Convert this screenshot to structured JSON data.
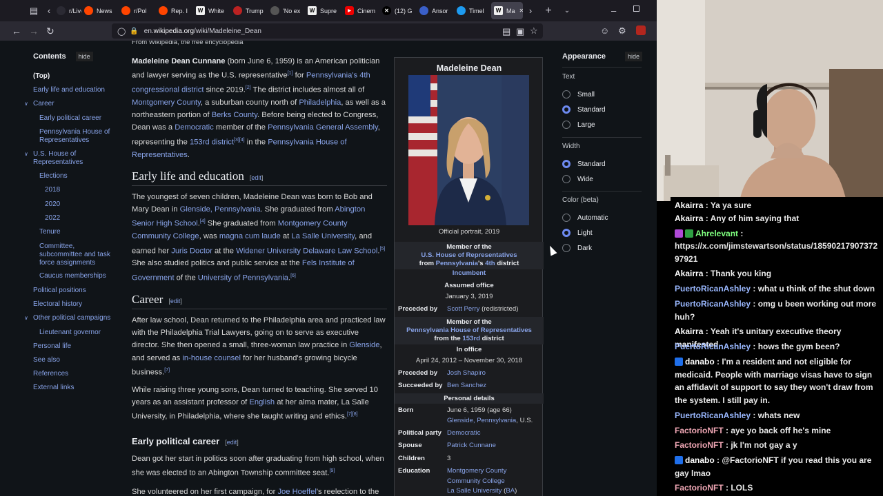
{
  "tabs": [
    {
      "label": "r/Live:",
      "fav": "",
      "color": "#2b2a33"
    },
    {
      "label": "News",
      "fav": "reddit",
      "color": "#ff4500"
    },
    {
      "label": "r/Pol",
      "fav": "reddit",
      "color": "#ff4500"
    },
    {
      "label": "Rep. I",
      "fav": "reddit",
      "color": "#ff4500"
    },
    {
      "label": "White",
      "fav": "W",
      "color": "#f0f0f0"
    },
    {
      "label": "Trump",
      "fav": "",
      "color": "#b22"
    },
    {
      "label": "'No ex",
      "fav": "",
      "color": "#555"
    },
    {
      "label": "Supre",
      "fav": "W",
      "color": "#f0f0f0"
    },
    {
      "label": "Cinem",
      "fav": "yt",
      "color": "#e00"
    },
    {
      "label": "(12) G",
      "fav": "X",
      "color": "#000"
    },
    {
      "label": "Ansor",
      "fav": "",
      "color": "#3a5fc8"
    },
    {
      "label": "Timel",
      "fav": "",
      "color": "#1d9bf0"
    },
    {
      "label": "Ma",
      "fav": "W",
      "color": "#f0f0f0",
      "active": true
    }
  ],
  "url": {
    "prefix": "en.",
    "host": "wikipedia.org",
    "path": "/wiki/Madeleine_Dean"
  },
  "from_wiki": "From Wikipedia, the free encyclopedia",
  "toc": {
    "title": "Contents",
    "hide": "hide",
    "items": [
      {
        "label": "(Top)",
        "top": true
      },
      {
        "label": "Early life and education"
      },
      {
        "label": "Career",
        "chev": true
      },
      {
        "label": "Early political career"
      },
      {
        "label": "Pennsylvania House of Representatives"
      },
      {
        "label": "U.S. House of Representatives",
        "chev": true
      },
      {
        "label": "Elections"
      },
      {
        "label": "2018"
      },
      {
        "label": "2020"
      },
      {
        "label": "2022"
      },
      {
        "label": "Tenure"
      },
      {
        "label": "Committee, subcommittee and task force assignments"
      },
      {
        "label": "Caucus memberships"
      },
      {
        "label": "Political positions"
      },
      {
        "label": "Electoral history"
      },
      {
        "label": "Other political campaigns",
        "chev": true
      },
      {
        "label": "Lieutenant governor"
      },
      {
        "label": "Personal life"
      },
      {
        "label": "See also"
      },
      {
        "label": "References"
      },
      {
        "label": "External links"
      }
    ]
  },
  "article": {
    "intro": {
      "name": "Madeleine Dean Cunnane",
      "t1": " (born June 6, 1959) is an American politician and lawyer serving as the U.S. representative",
      "r1": "[1]",
      "t2": " for ",
      "l1": "Pennsylvania's 4th congressional district",
      "t3": " since 2019.",
      "r2": "[2]",
      "t4": " The district includes almost all of ",
      "l2": "Montgomery County",
      "t5": ", a suburban county north of ",
      "l3": "Philadelphia",
      "t6": ", as well as a northeastern portion of ",
      "l4": "Berks County",
      "t7": ". Before being elected to Congress, Dean was a ",
      "l5": "Democratic",
      "t8": " member of the ",
      "l6": "Pennsylvania General Assembly",
      "t9": ", representing the ",
      "l7": "153rd district",
      "r3": "[3][4]",
      "t10": " in the ",
      "l8": "Pennsylvania House of Representatives",
      "t11": "."
    },
    "h_early": "Early life and education",
    "edit": "edit",
    "early": {
      "t1": "The youngest of seven children, Madeleine Dean was born to Bob and Mary Dean in ",
      "l1": "Glenside, Pennsylvania",
      "t2": ". She graduated from ",
      "l2": "Abington Senior High School",
      "t3": ".",
      "r1": "[4]",
      "t4": " She graduated from ",
      "l3": "Montgomery County Community College",
      "t5": ", was ",
      "l4": "magna cum laude",
      "t6": " at ",
      "l5": "La Salle University",
      "t7": ", and earned her ",
      "l6": "Juris Doctor",
      "t8": " at the ",
      "l7": "Widener University Delaware Law School",
      "t9": ".",
      "r2": "[5]",
      "t10": " She also studied politics and public service at the ",
      "l8": "Fels Institute of Government",
      "t11": " of the ",
      "l9": "University of Pennsylvania",
      "t12": ".",
      "r3": "[6]"
    },
    "h_career": "Career",
    "career1": {
      "t1": "After law school, Dean returned to the Philadelphia area and practiced law with the Philadelphia Trial Lawyers, going on to serve as executive director. She then opened a small, three-woman law practice in ",
      "l1": "Glenside",
      "t2": ", and served as ",
      "l2": "in-house counsel",
      "t3": " for her husband's growing bicycle business.",
      "r1": "[7]"
    },
    "career2": {
      "t1": "While raising three young sons, Dean turned to teaching. She served 10 years as an assistant professor of ",
      "l1": "English",
      "t2": " at her alma mater, La Salle University, in Philadelphia, where she taught writing and ethics.",
      "r1": "[7][8]"
    },
    "h_early_pol": "Early political career",
    "early_pol": {
      "t1": "Dean got her start in politics soon after graduating from high school, when she was elected to an Abington Township committee seat.",
      "r1": "[9]"
    },
    "volunteer": {
      "t1": "She volunteered on her first campaign, for ",
      "l1": "Joe Hoeffel",
      "t2": "'s reelection to the"
    }
  },
  "infobox": {
    "title": "Madeleine Dean",
    "caption": "Official portrait, 2019",
    "member_of": "Member of the",
    "office1_link": "U.S. House of Representatives",
    "office1_from": "from ",
    "office1_state": "Pennsylvania",
    "office1_poss": "'s ",
    "office1_dist": "4th",
    "office1_tail": " district",
    "incumbent": "Incumbent",
    "assumed": "Assumed office",
    "assumed_date": "January 3, 2019",
    "preceded_by": "Preceded by",
    "prec1": "Scott Perry",
    "prec1_note": " (redistricted)",
    "office2_member": "Member of the",
    "office2_link": "Pennsylvania House of Representatives",
    "office2_from": "from the ",
    "office2_dist": "153rd",
    "office2_tail": " district",
    "in_office": "In office",
    "in_office_dates": "April 24, 2012 – November 30, 2018",
    "prec2": "Josh Shapiro",
    "succeeded_by": "Succeeded by",
    "succ2": "Ben Sanchez",
    "personal": "Personal details",
    "born_k": "Born",
    "born_v": "June 6, 1959 (age 66)",
    "born_place": "Glenside, Pennsylvania",
    "born_country": ", U.S.",
    "party_k": "Political party",
    "party_v": "Democratic",
    "spouse_k": "Spouse",
    "spouse_v": "Patrick Cunnane",
    "children_k": "Children",
    "children_v": "3",
    "edu_k": "Education",
    "edu_v1": "Montgomery County Community College",
    "edu_v2": "La Salle University",
    "edu_v3": "BA"
  },
  "appearance": {
    "title": "Appearance",
    "hide": "hide",
    "text_label": "Text",
    "text_opts": [
      {
        "label": "Small",
        "on": false
      },
      {
        "label": "Standard",
        "on": true
      },
      {
        "label": "Large",
        "on": false
      }
    ],
    "width_label": "Width",
    "width_opts": [
      {
        "label": "Standard",
        "on": true
      },
      {
        "label": "Wide",
        "on": false
      }
    ],
    "color_label": "Color (beta)",
    "color_opts": [
      {
        "label": "Automatic",
        "on": false
      },
      {
        "label": "Light",
        "on": true
      },
      {
        "label": "Dark",
        "on": false
      }
    ]
  },
  "chat": [
    {
      "user": "Akairra",
      "color": "#ffffff",
      "text": " : Ya ya sure"
    },
    {
      "user": "Akairra",
      "color": "#ffffff",
      "text": " : Any of him saying that"
    },
    {
      "user": "Ahrelevant",
      "color": "#7fff7f",
      "text": " :",
      "badges": [
        "#b04ad8",
        "#2ea043"
      ]
    },
    {
      "user": "",
      "color": "#ffffff",
      "text": "https://x.com/jimstewartson/status/1859021790737297921"
    },
    {
      "user": "Akairra",
      "color": "#ffffff",
      "text": " : Thank you king"
    },
    {
      "user": "PuertoRicanAshley",
      "color": "#9ab8ff",
      "text": " : what u think of the shut down"
    },
    {
      "user": "PuertoRicanAshley",
      "color": "#9ab8ff",
      "text": " : omg u been working out more huh?"
    },
    {
      "user": "Akairra",
      "color": "#ffffff",
      "text": " : Yeah it's unitary executive theory manifested"
    },
    {
      "user": "PuertoRicanAshley",
      "color": "#9ab8ff",
      "text": " : hows the gym been?"
    },
    {
      "user": "danabo",
      "color": "#ffffff",
      "text": " : I'm a resident and not eligible for medicaid. People with marriage visas have to sign an affidavit of support to say they won't draw from the system. I still pay in.",
      "badges": [
        "#1f6feb"
      ]
    },
    {
      "user": "PuertoRicanAshley",
      "color": "#9ab8ff",
      "text": " : whats new"
    },
    {
      "user": "FactorioNFT",
      "color": "#f0a7b5",
      "text": " : aye yo back off he's mine"
    },
    {
      "user": "FactorioNFT",
      "color": "#f0a7b5",
      "text": " : jk I'm not gay a y"
    },
    {
      "user": "danabo",
      "color": "#ffffff",
      "text": " : @FactorioNFT if you read this you are gay lmao",
      "badges": [
        "#1f6feb"
      ]
    },
    {
      "user": "FactorioNFT",
      "color": "#f0a7b5",
      "text": " : LOLS"
    }
  ]
}
